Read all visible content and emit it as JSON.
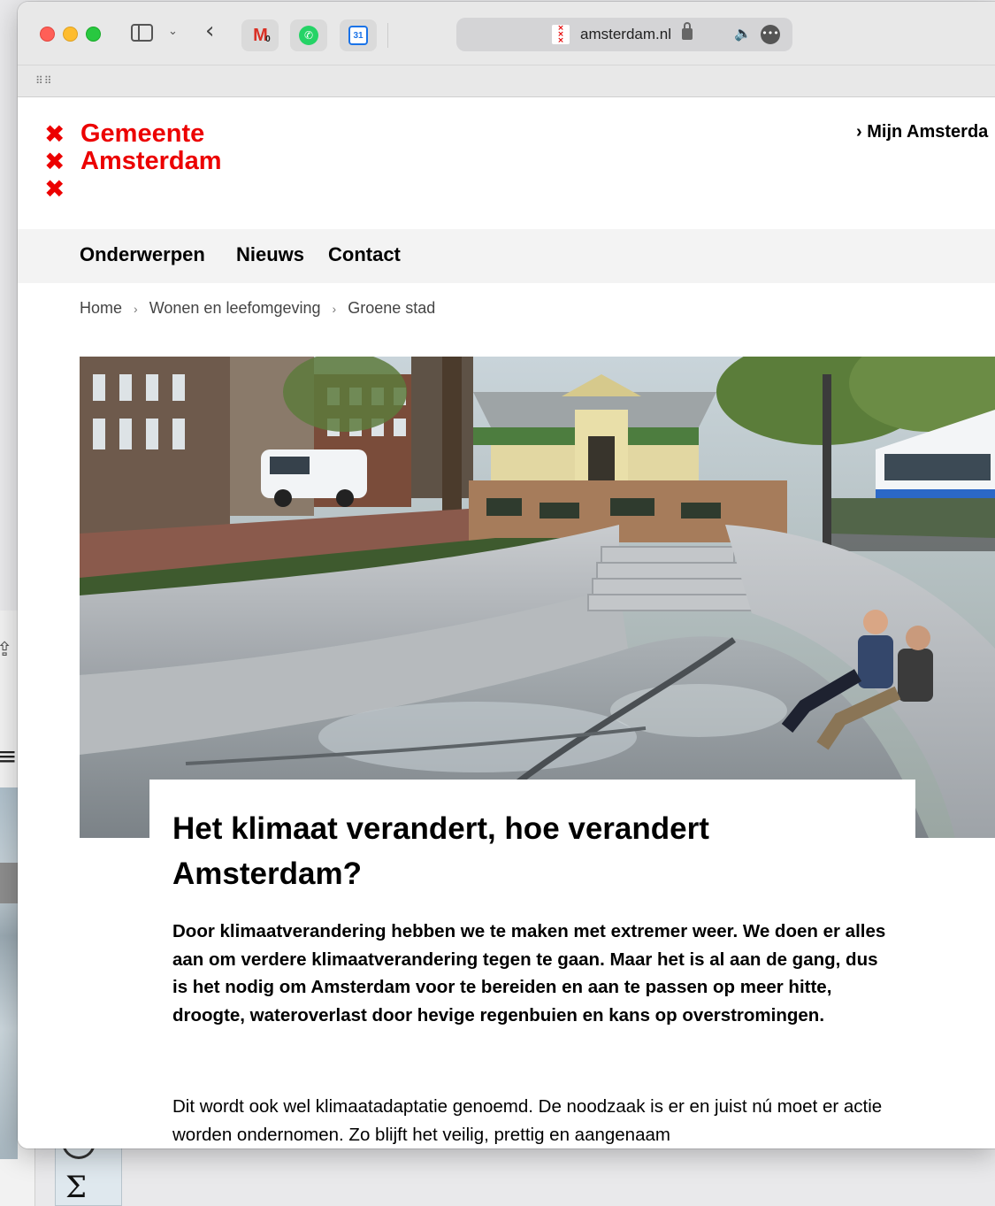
{
  "browser": {
    "url": "amsterdam.nl",
    "pinned_tabs": [
      {
        "name": "gmail",
        "badge": "0"
      },
      {
        "name": "whatsapp"
      },
      {
        "name": "google-calendar",
        "day": "31"
      }
    ]
  },
  "site": {
    "logo_lines": [
      "Gemeente",
      "Amsterdam"
    ],
    "mijn_link": "Mijn Amsterda",
    "nav": [
      "Onderwerpen",
      "Nieuws",
      "Contact"
    ],
    "breadcrumb": [
      "Home",
      "Wonen en leefomgeving",
      "Groene stad"
    ]
  },
  "article": {
    "title": "Het klimaat verandert, hoe verandert Amsterdam?",
    "lead": "Door klimaatverandering hebben we te maken met extremer weer. We doen er alles aan om verdere klimaatverandering tegen te gaan. Maar het is al aan de gang, dus is het nodig om Amsterdam voor te bereiden en aan te passen op meer hitte, droogte, wateroverlast door hevige regenbuien en kans op overstromingen.",
    "body": "Dit wordt ook wel klimaatadaptatie genoemd. De noodzaak is er en juist nú moet er actie worden ondernomen. Zo blijft het veilig, prettig en aangenaam"
  },
  "colors": {
    "brand_red": "#ec0000",
    "nav_background": "#f3f3f3"
  },
  "icons": [
    "sidebar-icon",
    "back-arrow-icon",
    "lock-icon",
    "speaker-icon",
    "more-icon",
    "grid-icon",
    "chevron-right-icon",
    "share-icon",
    "menu-icon",
    "sigma-icon"
  ]
}
